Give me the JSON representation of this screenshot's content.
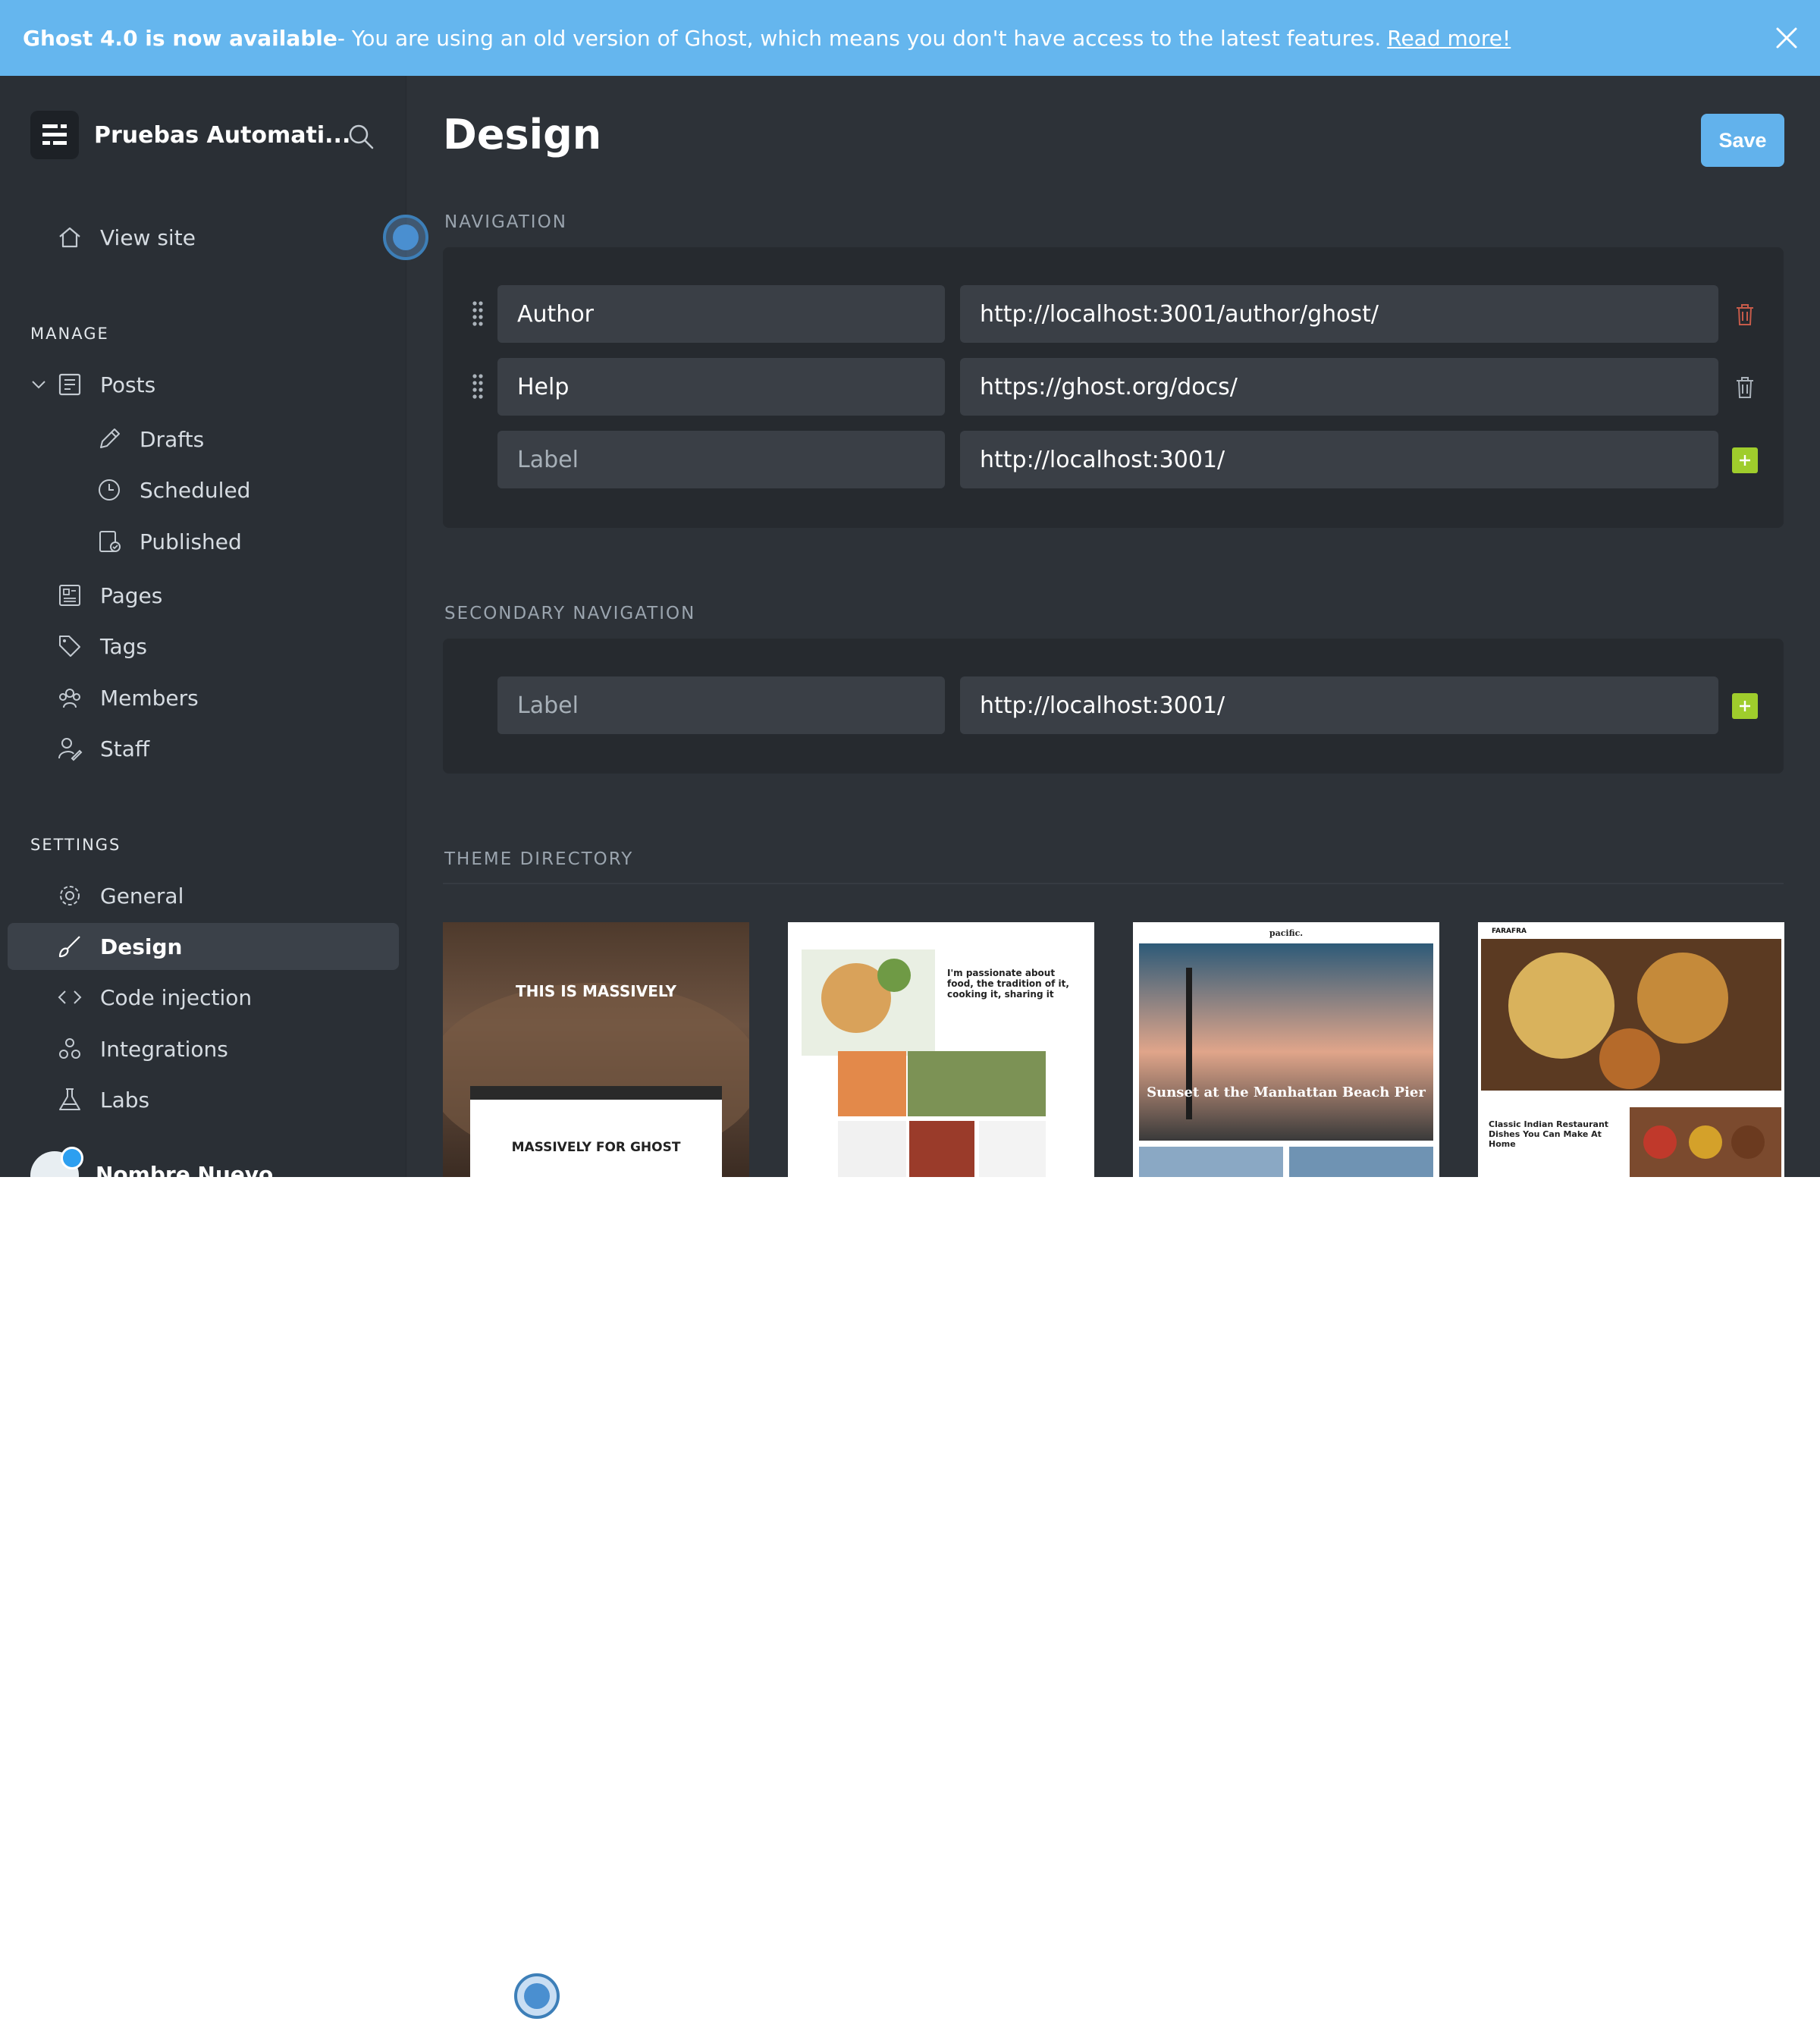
{
  "banner": {
    "bold_text": "Ghost 4.0 is now available",
    "text": " - You are using an old version of Ghost, which means you don't have access to the latest features.",
    "link": "Read more!"
  },
  "sidebar": {
    "site_name": "Pruebas Automati...",
    "view_site": "View site",
    "manage_header": "MANAGE",
    "manage_items": [
      {
        "label": "Posts",
        "icon": "posts-icon"
      },
      {
        "label": "Drafts",
        "icon": "pencil-icon"
      },
      {
        "label": "Scheduled",
        "icon": "clock-icon"
      },
      {
        "label": "Published",
        "icon": "published-icon"
      },
      {
        "label": "Pages",
        "icon": "pages-icon"
      },
      {
        "label": "Tags",
        "icon": "tag-icon"
      },
      {
        "label": "Members",
        "icon": "members-icon"
      },
      {
        "label": "Staff",
        "icon": "staff-icon"
      }
    ],
    "settings_header": "SETTINGS",
    "settings_items": [
      {
        "label": "General",
        "icon": "gear-icon"
      },
      {
        "label": "Design",
        "icon": "brush-icon",
        "active": true
      },
      {
        "label": "Code injection",
        "icon": "code-icon"
      },
      {
        "label": "Integrations",
        "icon": "integrations-icon"
      },
      {
        "label": "Labs",
        "icon": "flask-icon"
      }
    ],
    "user_name": "Nombre Nuevo"
  },
  "main": {
    "title": "Design",
    "save_label": "Save",
    "navigation_header": "NAVIGATION",
    "navigation": [
      {
        "label": "Author",
        "url": "http://localhost:3001/author/ghost/"
      },
      {
        "label": "Help",
        "url": "https://ghost.org/docs/"
      }
    ],
    "navigation_new": {
      "label_placeholder": "Label",
      "url": "http://localhost:3001/"
    },
    "secondary_header": "SECONDARY NAVIGATION",
    "secondary_new": {
      "label_placeholder": "Label",
      "url": "http://localhost:3001/"
    },
    "theme_header": "THEME DIRECTORY",
    "themes": {
      "massively": {
        "title": "THIS IS MASSIVELY",
        "subtitle": "MASSIVELY FOR GHOST"
      },
      "edition": {
        "headline": "I'm passionate about food, the tradition of it, cooking it, sharing it"
      },
      "pacific": {
        "brand": "pacific.",
        "headline": "Sunset at the Manhattan Beach Pier"
      },
      "alto": {
        "brand": "FARAFRA",
        "headline": "Classic Indian Restaurant Dishes You Can Make At Home"
      }
    }
  },
  "colors": {
    "banner": "#65b6ee",
    "sidebar": "#2a2f35",
    "main": "#2d3238",
    "save": "#62b2ec",
    "plus": "#9fcd2c",
    "trash": "#c65b4a"
  }
}
